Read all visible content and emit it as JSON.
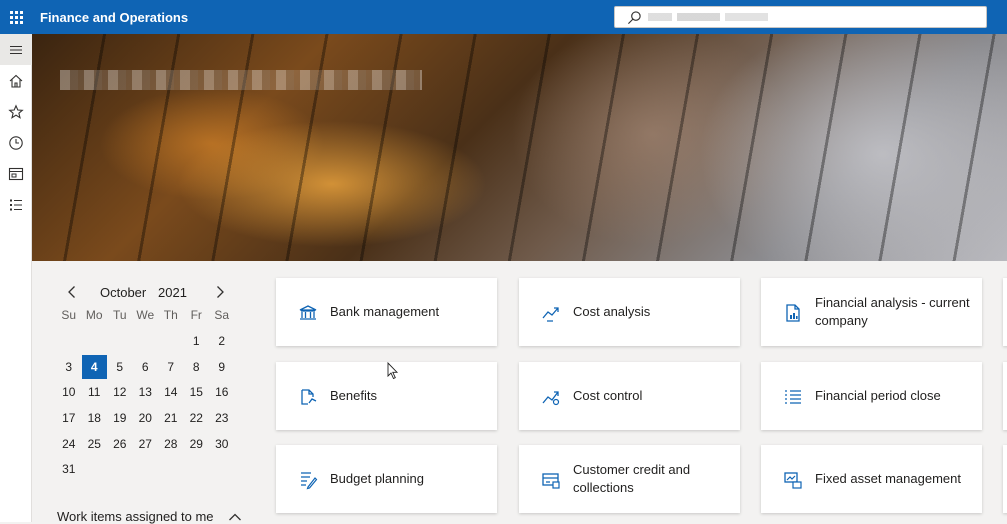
{
  "app": {
    "title": "Finance and Operations"
  },
  "search": {
    "placeholder": ""
  },
  "nav": {
    "items": [
      {
        "name": "hamburger-icon"
      },
      {
        "name": "home-icon"
      },
      {
        "name": "star-icon"
      },
      {
        "name": "clock-icon"
      },
      {
        "name": "workspace-icon"
      },
      {
        "name": "modules-list-icon"
      }
    ]
  },
  "calendar": {
    "month": "October",
    "year": "2021",
    "weekdays": [
      "Su",
      "Mo",
      "Tu",
      "We",
      "Th",
      "Fr",
      "Sa"
    ],
    "weeks": [
      [
        "",
        "",
        "",
        "",
        "",
        "1",
        "2"
      ],
      [
        "3",
        "4",
        "5",
        "6",
        "7",
        "8",
        "9"
      ],
      [
        "10",
        "11",
        "12",
        "13",
        "14",
        "15",
        "16"
      ],
      [
        "17",
        "18",
        "19",
        "20",
        "21",
        "22",
        "23"
      ],
      [
        "24",
        "25",
        "26",
        "27",
        "28",
        "29",
        "30"
      ],
      [
        "31",
        "",
        "",
        "",
        "",
        "",
        ""
      ]
    ],
    "selected_day": "4"
  },
  "work_items": {
    "label": "Work items assigned to me"
  },
  "tiles": [
    {
      "label": "Bank management",
      "icon": "bank-icon"
    },
    {
      "label": "Cost analysis",
      "icon": "trend-icon"
    },
    {
      "label": "Financial analysis - current company",
      "icon": "report-icon"
    },
    {
      "label": "Benefits",
      "icon": "benefits-icon"
    },
    {
      "label": "Cost control",
      "icon": "cost-control-icon"
    },
    {
      "label": "Financial period close",
      "icon": "checklist-icon"
    },
    {
      "label": "Budget planning",
      "icon": "budget-icon"
    },
    {
      "label": "Customer credit and collections",
      "icon": "credit-icon"
    },
    {
      "label": "Fixed asset management",
      "icon": "asset-icon"
    }
  ],
  "colors": {
    "accent": "#0f64b4",
    "background": "#f3f2f1"
  }
}
